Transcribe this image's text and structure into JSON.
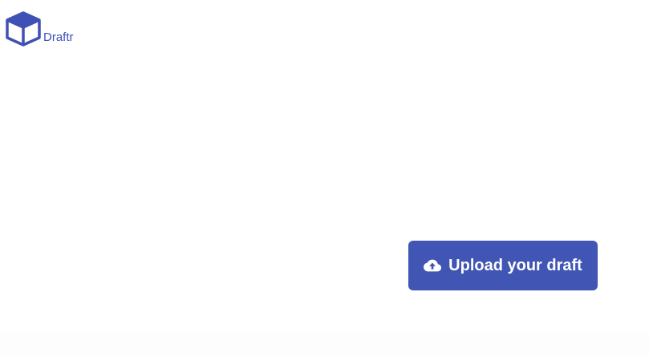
{
  "brand": {
    "name": "Draftr",
    "logo_icon": "cube-icon",
    "color": "#3f51b5"
  },
  "main": {
    "upload_button": {
      "label": "Upload your draft",
      "icon": "cloud-upload-icon",
      "background": "#4155b4",
      "text_color": "#ffffff"
    }
  }
}
